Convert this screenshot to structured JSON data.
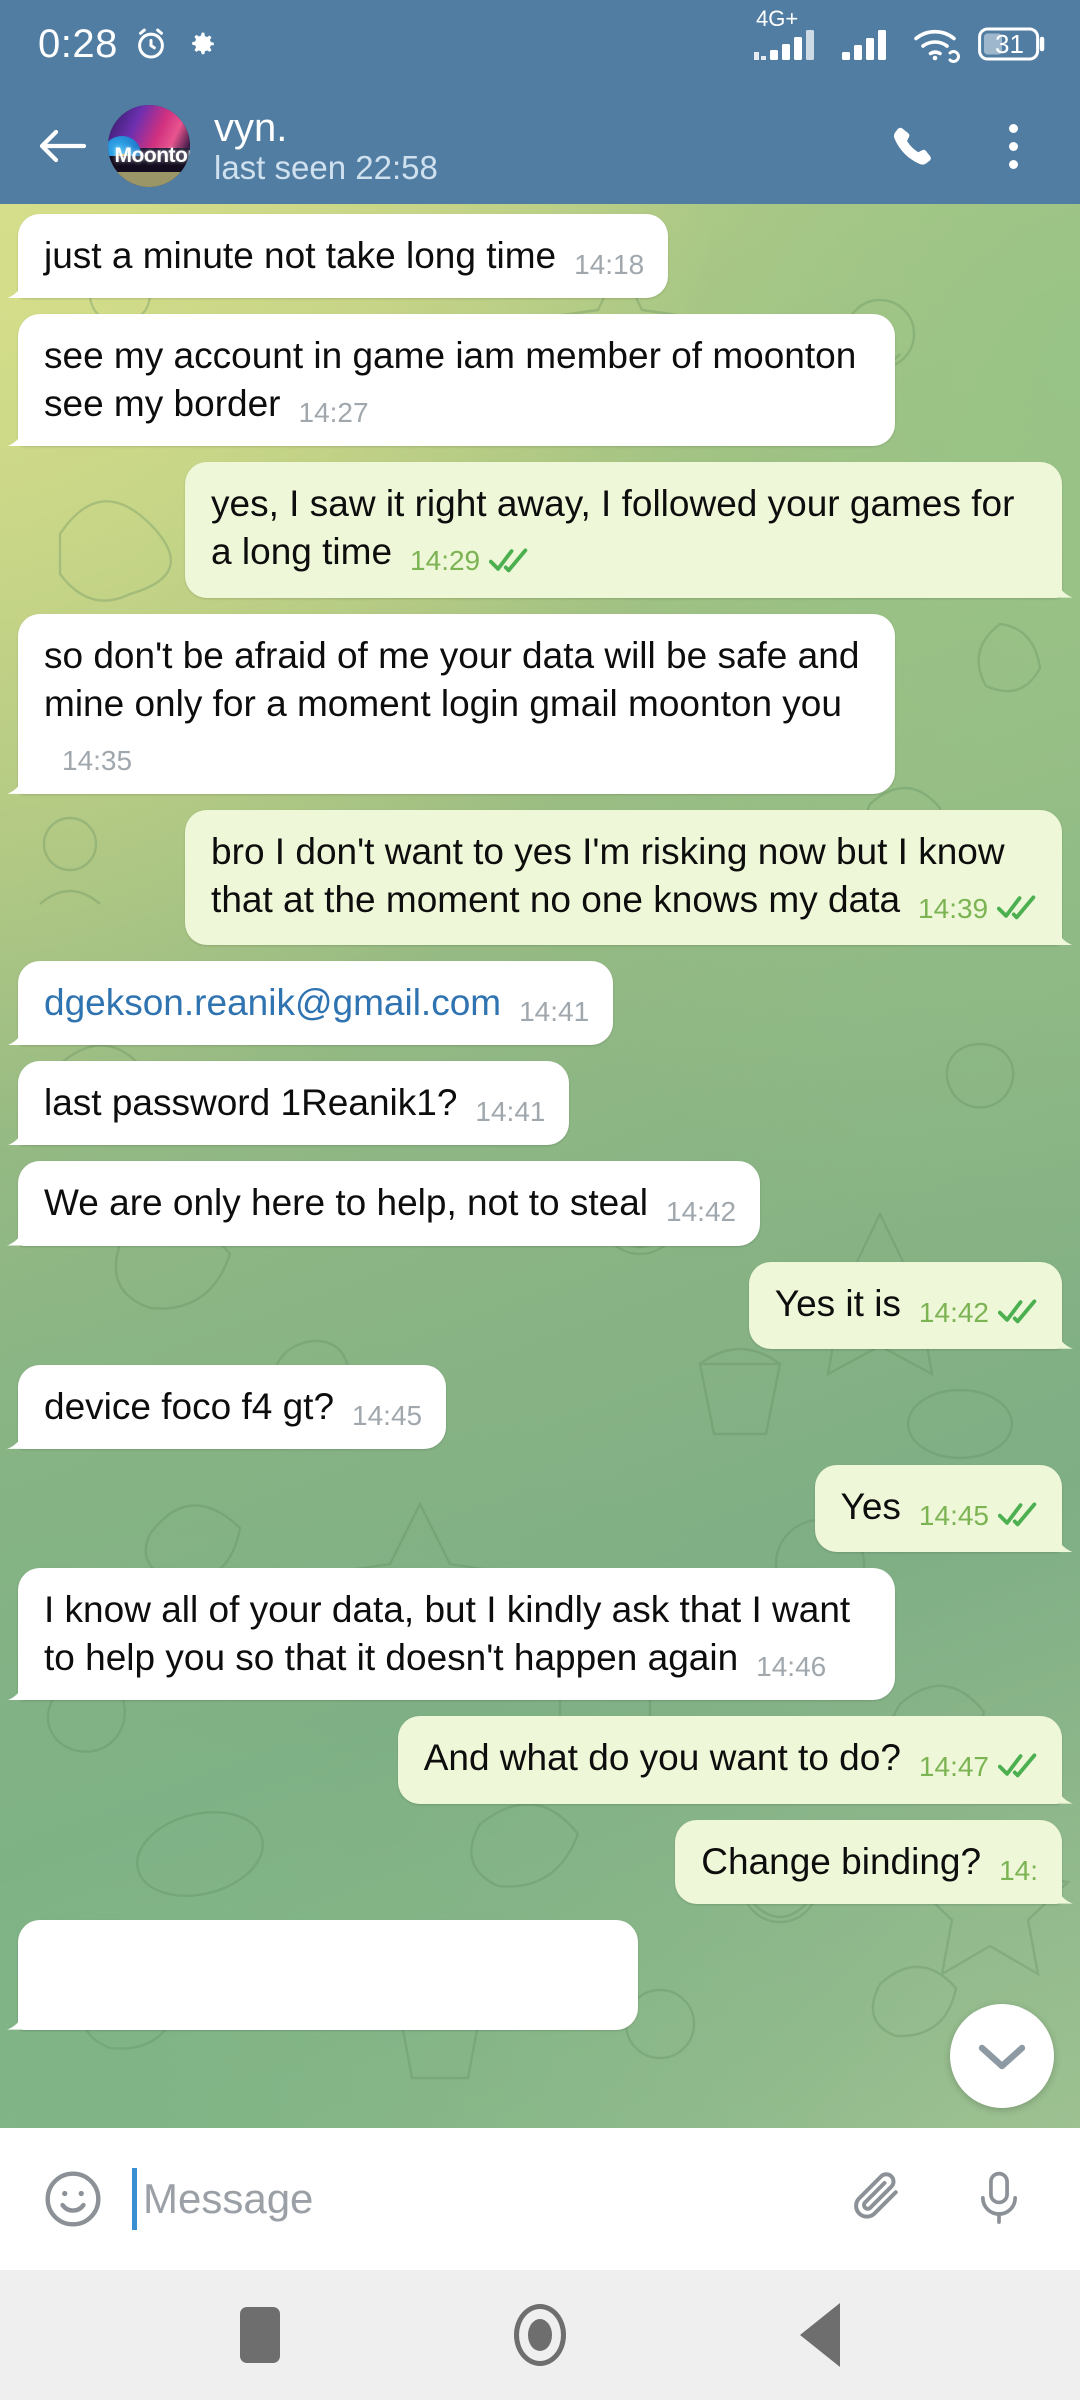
{
  "statusbar": {
    "clock": "0:28",
    "alarm_icon": "alarm-icon",
    "settings_icon": "gear-icon",
    "network_label": "4G+",
    "signal1_icon": "signal-bars-icon",
    "signal2_icon": "signal-bars-icon",
    "wifi_icon": "wifi-icon",
    "battery_level": "31"
  },
  "header": {
    "back_icon": "back-arrow-icon",
    "avatar_label": "Moonton",
    "title": "vyn.",
    "subtitle": "last seen 22:58",
    "call_icon": "phone-icon",
    "menu_icon": "more-vertical-icon"
  },
  "chat": {
    "scroll_down_icon": "chevron-down-icon",
    "messages": [
      {
        "dir": "in",
        "text": "just a minute not take long time",
        "time": "14:18",
        "link": false,
        "ticks": false
      },
      {
        "dir": "in",
        "text": "see my account in game iam member of moonton see my border",
        "time": "14:27",
        "link": false,
        "ticks": false
      },
      {
        "dir": "out",
        "text": "yes, I saw it right away, I followed your games for a long time",
        "time": "14:29",
        "link": false,
        "ticks": true
      },
      {
        "dir": "in",
        "text": "so don't be afraid of me your data will be safe and mine only for a moment login gmail moonton you",
        "time": "14:35",
        "link": false,
        "ticks": false
      },
      {
        "dir": "out",
        "text": "bro I don't want to yes I'm risking now but I know that at the moment no one knows my data",
        "time": "14:39",
        "link": false,
        "ticks": true
      },
      {
        "dir": "in",
        "text": "dgekson.reanik@gmail.com",
        "time": "14:41",
        "link": true,
        "ticks": false
      },
      {
        "dir": "in",
        "text": "last password 1Reanik1?",
        "time": "14:41",
        "link": false,
        "ticks": false
      },
      {
        "dir": "in",
        "text": "We are only here to help, not to steal",
        "time": "14:42",
        "link": false,
        "ticks": false
      },
      {
        "dir": "out",
        "text": "Yes it is",
        "time": "14:42",
        "link": false,
        "ticks": true
      },
      {
        "dir": "in",
        "text": "device foco f4 gt?",
        "time": "14:45",
        "link": false,
        "ticks": false
      },
      {
        "dir": "out",
        "text": "Yes",
        "time": "14:45",
        "link": false,
        "ticks": true
      },
      {
        "dir": "in",
        "text": "I know all of your data, but I kindly ask that I want to help you so that it doesn't happen again",
        "time": "14:46",
        "link": false,
        "ticks": false
      },
      {
        "dir": "out",
        "text": "And what do you want to do?",
        "time": "14:47",
        "link": false,
        "ticks": true
      },
      {
        "dir": "out",
        "text": "Change binding?",
        "time": "14:",
        "link": false,
        "ticks": false
      }
    ]
  },
  "input": {
    "emoji_icon": "smiley-icon",
    "placeholder": "Message",
    "value": "",
    "attach_icon": "paperclip-icon",
    "mic_icon": "microphone-icon"
  },
  "navbar": {
    "recents_icon": "recents-square-icon",
    "home_icon": "home-circle-icon",
    "back_icon": "back-triangle-icon"
  },
  "colors": {
    "header": "#517da2",
    "bubble_in": "#ffffff",
    "bubble_out": "#eef7d8",
    "link": "#2f73b0",
    "tick": "#4caf50",
    "navbar": "#efeff0"
  }
}
